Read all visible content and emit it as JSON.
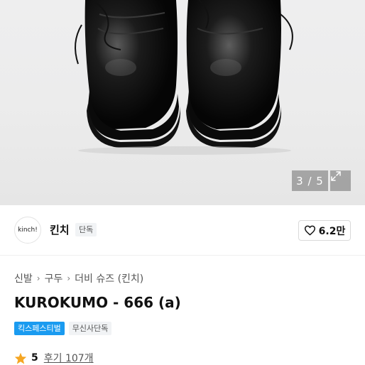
{
  "gallery": {
    "image_alt": "",
    "current": "3",
    "total": "5",
    "counter": "3 / 5",
    "expand_icon": "expand-icon"
  },
  "brand": {
    "logo_text": "kinch!",
    "name": "킨치",
    "tag": "단독",
    "like_icon": "heart-outline-icon",
    "like_count": "6.2만"
  },
  "breadcrumb": {
    "items": [
      "신발",
      "구두",
      "더비 슈즈 (킨치)"
    ],
    "separator_icon": "chevron-right-icon"
  },
  "product": {
    "title": "KUROKUMO - 666 (a)"
  },
  "badges": {
    "festival": "킥스페스티벌",
    "exclusive": "무신사단독"
  },
  "rating": {
    "star_icon": "star-icon",
    "value": "5",
    "review_text": "후기 107개"
  },
  "colors": {
    "festival_badge": "#1a9bf0",
    "star": "#f5a623",
    "tag_bg": "#f1f3f5"
  }
}
